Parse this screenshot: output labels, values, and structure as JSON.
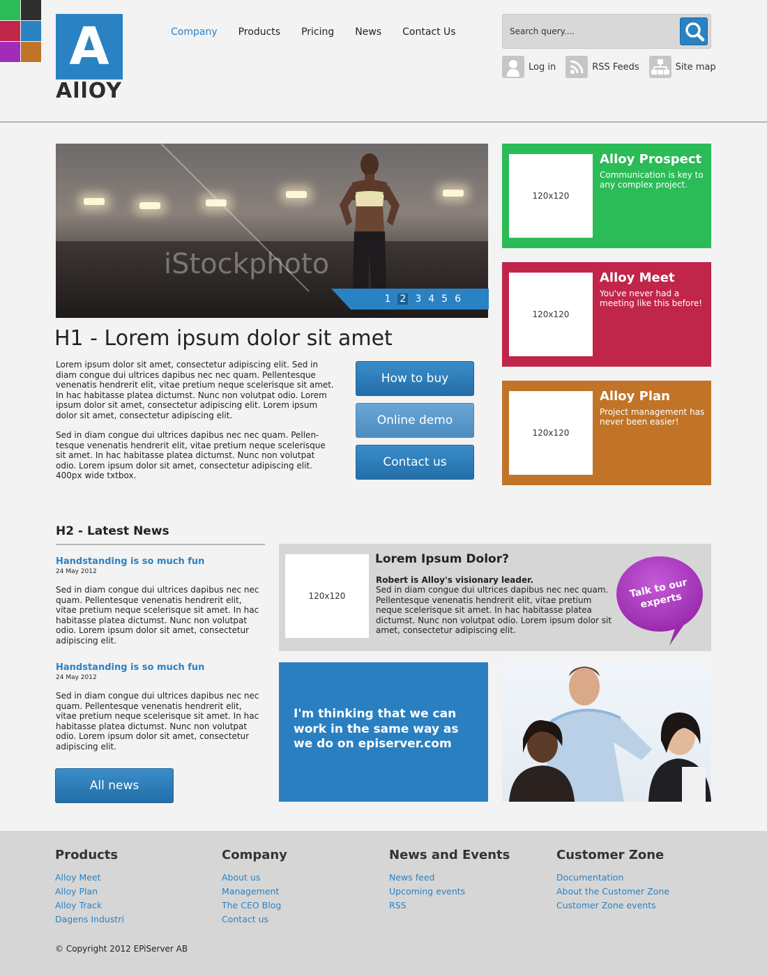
{
  "brand": {
    "logo_letter": "A",
    "logo_word": "AllOY"
  },
  "corner_colors": [
    "#2bbb57",
    "#2e2e2e",
    "#c0264a",
    "#2a82c3",
    "#a12cb8",
    "#c17428"
  ],
  "nav": {
    "items": [
      "Company",
      "Products",
      "Pricing",
      "News",
      "Contact Us"
    ],
    "active": "Company"
  },
  "search": {
    "placeholder": "Search query....",
    "icon": "search-icon"
  },
  "utils": [
    {
      "label": "Log in",
      "icon": "user-icon"
    },
    {
      "label": "RSS Feeds",
      "icon": "rss-icon"
    },
    {
      "label": "Site map",
      "icon": "sitemap-icon"
    }
  ],
  "hero": {
    "watermark": "iStockphoto",
    "pages": [
      "1",
      "2",
      "3",
      "4",
      "5",
      "6"
    ],
    "current_page": "2"
  },
  "tiles": [
    {
      "title": "Alloy Prospect",
      "text": "Communication is key to any complex project.",
      "placeholder": "120x120",
      "color": "#2bbb57"
    },
    {
      "title": "Alloy Meet",
      "text": "You've never had a meeting like this before!",
      "placeholder": "120x120",
      "color": "#c0264a"
    },
    {
      "title": "Alloy Plan",
      "text": "Project management has never been easier!",
      "placeholder": "120x120",
      "color": "#c17428"
    }
  ],
  "main": {
    "h1": "H1 - Lorem ipsum dolor sit amet",
    "p1": "Lorem ipsum dolor sit amet, consectetur adipiscing elit. Sed in diam congue dui ultrices dapibus nec nec quam. Pellentesque venenatis hendrerit elit, vitae pretium neque scelerisque sit amet. In hac habitasse platea dictumst. Nunc non volutpat odio. Lorem ipsum dolor sit amet, consectetur adipiscing elit. Lorem ipsum dolor sit amet, consectetur adipiscing elit.",
    "p2": "Sed in diam congue dui ultrices dapibus nec nec quam. Pellen-tesque venenatis hendrerit elit, vitae pretium neque scelerisque sit amet. In hac habitasse platea dictumst. Nunc non volutpat odio. Lorem ipsum dolor sit amet, consectetur adipiscing elit. 400px wide txtbox.",
    "buttons": [
      "How to buy",
      "Online demo",
      "Contact us"
    ]
  },
  "news": {
    "heading": "H2 - Latest News",
    "items": [
      {
        "title": "Handstanding is so much fun",
        "date": "24 May 2012",
        "text": "Sed in diam congue dui ultrices dapibus nec nec quam. Pellentesque venenatis hendrerit elit, vitae pretium neque scelerisque sit amet. In hac habitasse platea dictumst. Nunc non volutpat odio. Lorem ipsum dolor sit amet, consectetur adipiscing elit."
      },
      {
        "title": "Handstanding is so much fun",
        "date": "24 May 2012",
        "text": "Sed in diam congue dui ultrices dapibus nec nec quam. Pellentesque venenatis hendrerit elit, vitae pretium neque scelerisque sit amet. In hac habitasse platea dictumst. Nunc non volutpat odio. Lorem ipsum dolor sit amet, consectetur adipiscing elit."
      }
    ],
    "all_news": "All news"
  },
  "feature": {
    "placeholder": "120x120",
    "title": "Lorem Ipsum Dolor?",
    "lead": "Robert is Alloy's visionary leader.",
    "body": "Sed in diam congue dui ultrices dapibus nec nec quam. Pellentesque venenatis hendrerit elit, vitae pretium neque scelerisque sit amet. In hac habitasse platea dictumst. Nunc non volutpat odio. Lorem ipsum dolor sit amet, consectetur adipiscing elit.",
    "bubble_line1": "Talk to our",
    "bubble_line2": "experts"
  },
  "quote": "I'm thinking that we can work in the same way as we do on episerver.com",
  "footer": {
    "columns": [
      {
        "heading": "Products",
        "links": [
          "Alloy Meet",
          "Alloy Plan",
          "Alloy Track",
          "Dagens Industri"
        ]
      },
      {
        "heading": "Company",
        "links": [
          "About us",
          "Management",
          "The CEO Blog",
          "Contact us"
        ]
      },
      {
        "heading": "News and Events",
        "links": [
          "News feed",
          "Upcoming events",
          "RSS"
        ]
      },
      {
        "heading": "Customer Zone",
        "links": [
          "Documentation",
          "About the Customer Zone",
          "Customer Zone events"
        ]
      }
    ],
    "copyright": "© Copyright 2012 EPiServer AB"
  }
}
